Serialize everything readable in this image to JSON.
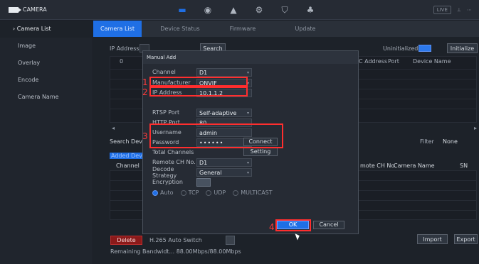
{
  "app": {
    "title": "CAMERA",
    "status": "LIVE"
  },
  "top_icons": [
    "camera-icon",
    "network-icon",
    "storage-icon",
    "settings-icon",
    "shield-icon",
    "user-icon"
  ],
  "sidebar": {
    "items": [
      {
        "label": "Camera List",
        "active": true
      },
      {
        "label": "Image",
        "active": false
      },
      {
        "label": "Overlay",
        "active": false
      },
      {
        "label": "Encode",
        "active": false
      },
      {
        "label": "Camera Name",
        "active": false
      }
    ]
  },
  "tabs": [
    {
      "label": "Camera List",
      "active": true
    },
    {
      "label": "Device Status",
      "active": false
    },
    {
      "label": "Firmware",
      "active": false
    },
    {
      "label": "Update",
      "active": false
    }
  ],
  "filter_bar": {
    "ip_label": "IP Address",
    "search_label": "Search",
    "uninitialized_label": "Uninitialized",
    "initialize_label": "Initialize"
  },
  "table_headers": {
    "top": {
      "col_0": "0",
      "mac": "C Address",
      "port": "Port",
      "device_name": "Device Name"
    },
    "bottom": {
      "channel": "Channel",
      "remote_ch": "mote CH No.",
      "camera_name": "Camera Name",
      "sn": "SN"
    }
  },
  "middle": {
    "search_devices": "Search Dev",
    "added_devices": "Added Devi",
    "filter_label": "Filter",
    "filter_value": "None"
  },
  "modal": {
    "title": "Manual Add",
    "fields": {
      "channel": {
        "label": "Channel",
        "value": "D1"
      },
      "manufacturer": {
        "label": "Manufacturer",
        "value": "ONVIF"
      },
      "ip": {
        "label": "IP Address",
        "value": "10.1.1.2"
      },
      "rtsp": {
        "label": "RTSP Port",
        "value": "Self-adaptive"
      },
      "http": {
        "label": "HTTP Port",
        "value": "80"
      },
      "username": {
        "label": "Username",
        "value": "admin"
      },
      "password": {
        "label": "Password",
        "value": "••••••"
      },
      "total_channels": {
        "label": "Total Channels"
      },
      "remote_ch": {
        "label": "Remote CH No.",
        "value": "D1"
      },
      "decode": {
        "label": "Decode Strategy",
        "value": "General"
      },
      "encryption": {
        "label": "Encryption"
      }
    },
    "buttons": {
      "connect": "Connect",
      "setting": "Setting",
      "ok": "OK",
      "cancel": "Cancel"
    },
    "protocols": [
      "Auto",
      "TCP",
      "UDP",
      "MULTICAST"
    ],
    "protocol_selected": "Auto"
  },
  "annotations": [
    "1",
    "2",
    "3",
    "4"
  ],
  "bottom": {
    "delete_label": "Delete",
    "h265": "H.265 Auto Switch",
    "bandwidth": "Remaining Bandwidt... 88.00Mbps/88.00Mbps",
    "import_label": "Import",
    "export_label": "Export"
  },
  "colors": {
    "accent": "#1f6fe5",
    "alert": "#ff2e2e"
  }
}
